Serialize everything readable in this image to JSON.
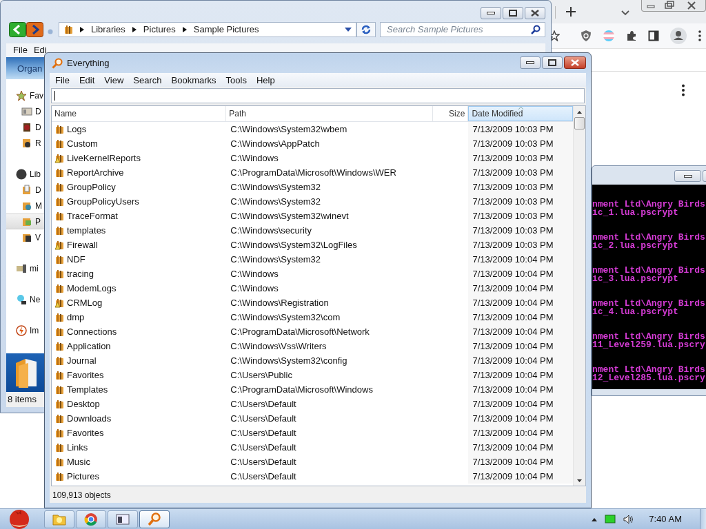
{
  "explorer": {
    "address": {
      "crumbs": [
        "Libraries",
        "Pictures",
        "Sample Pictures"
      ]
    },
    "search": {
      "placeholder": "Search Sample Pictures"
    },
    "menu": [
      "File",
      "Edi"
    ],
    "toolbar": {
      "label": "Organ"
    },
    "nav_groups": [
      [
        {
          "label": "Fav",
          "kind": "star",
          "selected": false
        },
        {
          "label": "D",
          "kind": "desktop",
          "selected": false
        },
        {
          "label": "D",
          "kind": "download",
          "selected": false
        },
        {
          "label": "R",
          "kind": "recent",
          "selected": false
        }
      ],
      [
        {
          "label": "Lib",
          "kind": "library",
          "selected": false
        },
        {
          "label": "D",
          "kind": "documents",
          "selected": false
        },
        {
          "label": "M",
          "kind": "music",
          "selected": false
        },
        {
          "label": "P",
          "kind": "pictures",
          "selected": true
        },
        {
          "label": "V",
          "kind": "videos",
          "selected": false
        }
      ],
      [
        {
          "label": "mi",
          "kind": "computer",
          "selected": false
        }
      ],
      [
        {
          "label": "Ne",
          "kind": "network",
          "selected": false
        }
      ],
      [
        {
          "label": "Im",
          "kind": "flash",
          "selected": false
        }
      ]
    ],
    "status": "8 items"
  },
  "console": {
    "entries": [
      [
        "nment Ltd\\Angry Birds",
        "ic_1.lua.pscrypt"
      ],
      [
        "nment Ltd\\Angry Birds",
        "ic_2.lua.pscrypt"
      ],
      [
        "nment Ltd\\Angry Birds",
        "ic_3.lua.pscrypt"
      ],
      [
        "nment Ltd\\Angry Birds",
        "ic_4.lua.pscrypt"
      ],
      [
        "nment Ltd\\Angry Birds",
        "11_Level259.lua.pscry"
      ],
      [
        "nment Ltd\\Angry Birds",
        "12_Level285.lua.pscry"
      ]
    ]
  },
  "everything": {
    "window": {
      "title": "Everything"
    },
    "menu": [
      "File",
      "Edit",
      "View",
      "Search",
      "Bookmarks",
      "Tools",
      "Help"
    ],
    "columns": [
      {
        "label": "Name",
        "sorted": false
      },
      {
        "label": "Path",
        "sorted": false
      },
      {
        "label": "Size",
        "sorted": false
      },
      {
        "label": "Date Modified",
        "sorted": true
      }
    ],
    "rows": [
      {
        "name": "Logs",
        "path": "C:\\Windows\\System32\\wbem",
        "modified": "7/13/2009 10:03 PM",
        "locked": false
      },
      {
        "name": "Custom",
        "path": "C:\\Windows\\AppPatch",
        "modified": "7/13/2009 10:03 PM",
        "locked": false
      },
      {
        "name": "LiveKernelReports",
        "path": "C:\\Windows",
        "modified": "7/13/2009 10:03 PM",
        "locked": true
      },
      {
        "name": "ReportArchive",
        "path": "C:\\ProgramData\\Microsoft\\Windows\\WER",
        "modified": "7/13/2009 10:03 PM",
        "locked": false
      },
      {
        "name": "GroupPolicy",
        "path": "C:\\Windows\\System32",
        "modified": "7/13/2009 10:03 PM",
        "locked": false
      },
      {
        "name": "GroupPolicyUsers",
        "path": "C:\\Windows\\System32",
        "modified": "7/13/2009 10:03 PM",
        "locked": false
      },
      {
        "name": "TraceFormat",
        "path": "C:\\Windows\\System32\\winevt",
        "modified": "7/13/2009 10:03 PM",
        "locked": false
      },
      {
        "name": "templates",
        "path": "C:\\Windows\\security",
        "modified": "7/13/2009 10:03 PM",
        "locked": false
      },
      {
        "name": "Firewall",
        "path": "C:\\Windows\\System32\\LogFiles",
        "modified": "7/13/2009 10:03 PM",
        "locked": true
      },
      {
        "name": "NDF",
        "path": "C:\\Windows\\System32",
        "modified": "7/13/2009 10:04 PM",
        "locked": false
      },
      {
        "name": "tracing",
        "path": "C:\\Windows",
        "modified": "7/13/2009 10:04 PM",
        "locked": false
      },
      {
        "name": "ModemLogs",
        "path": "C:\\Windows",
        "modified": "7/13/2009 10:04 PM",
        "locked": false
      },
      {
        "name": "CRMLog",
        "path": "C:\\Windows\\Registration",
        "modified": "7/13/2009 10:04 PM",
        "locked": true
      },
      {
        "name": "dmp",
        "path": "C:\\Windows\\System32\\com",
        "modified": "7/13/2009 10:04 PM",
        "locked": false
      },
      {
        "name": "Connections",
        "path": "C:\\ProgramData\\Microsoft\\Network",
        "modified": "7/13/2009 10:04 PM",
        "locked": false
      },
      {
        "name": "Application",
        "path": "C:\\Windows\\Vss\\Writers",
        "modified": "7/13/2009 10:04 PM",
        "locked": false
      },
      {
        "name": "Journal",
        "path": "C:\\Windows\\System32\\config",
        "modified": "7/13/2009 10:04 PM",
        "locked": false
      },
      {
        "name": "Favorites",
        "path": "C:\\Users\\Public",
        "modified": "7/13/2009 10:04 PM",
        "locked": false
      },
      {
        "name": "Templates",
        "path": "C:\\ProgramData\\Microsoft\\Windows",
        "modified": "7/13/2009 10:04 PM",
        "locked": false
      },
      {
        "name": "Desktop",
        "path": "C:\\Users\\Default",
        "modified": "7/13/2009 10:04 PM",
        "locked": false
      },
      {
        "name": "Downloads",
        "path": "C:\\Users\\Default",
        "modified": "7/13/2009 10:04 PM",
        "locked": false
      },
      {
        "name": "Favorites",
        "path": "C:\\Users\\Default",
        "modified": "7/13/2009 10:04 PM",
        "locked": false
      },
      {
        "name": "Links",
        "path": "C:\\Users\\Default",
        "modified": "7/13/2009 10:04 PM",
        "locked": false
      },
      {
        "name": "Music",
        "path": "C:\\Users\\Default",
        "modified": "7/13/2009 10:04 PM",
        "locked": false
      },
      {
        "name": "Pictures",
        "path": "C:\\Users\\Default",
        "modified": "7/13/2009 10:04 PM",
        "locked": false
      }
    ],
    "status": "109,913 objects"
  },
  "taskbar": {
    "buttons": [
      {
        "kind": "folder",
        "selected": false
      },
      {
        "kind": "chrome",
        "selected": false
      },
      {
        "kind": "console",
        "selected": false
      },
      {
        "kind": "everything",
        "selected": true
      }
    ],
    "clock": "7:40 AM"
  }
}
